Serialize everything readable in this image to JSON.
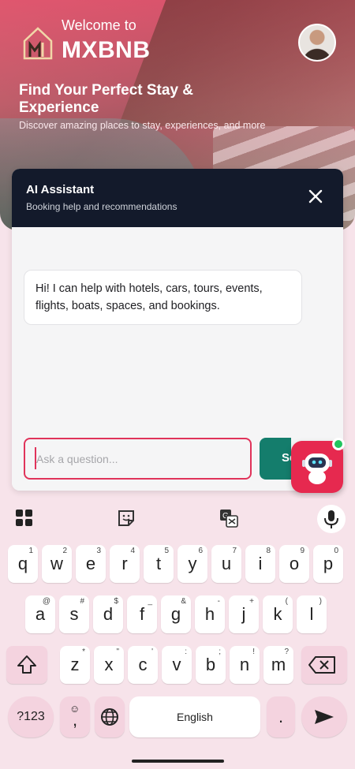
{
  "hero": {
    "welcome": "Welcome to",
    "brand": "MXBNB",
    "title": "Find Your Perfect Stay & Experience",
    "subtitle": "Discover amazing places to stay, experiences, and more"
  },
  "chat": {
    "title": "AI Assistant",
    "subtitle": "Booking help and recommendations",
    "message": "Hi! I can help with hotels, cars, tours, events, flights, boats, spaces, and bookings.",
    "input_placeholder": "Ask a question...",
    "input_value": "",
    "send_label": "Send"
  },
  "colors": {
    "accent": "#e6294f",
    "header_dark": "#131a2b",
    "send_green": "#147d6c",
    "online": "#22c55e"
  },
  "keyboard": {
    "row1": [
      {
        "k": "q",
        "h": "1"
      },
      {
        "k": "w",
        "h": "2"
      },
      {
        "k": "e",
        "h": "3"
      },
      {
        "k": "r",
        "h": "4"
      },
      {
        "k": "t",
        "h": "5"
      },
      {
        "k": "y",
        "h": "6"
      },
      {
        "k": "u",
        "h": "7"
      },
      {
        "k": "i",
        "h": "8"
      },
      {
        "k": "o",
        "h": "9"
      },
      {
        "k": "p",
        "h": "0"
      }
    ],
    "row2": [
      {
        "k": "a",
        "h": "@"
      },
      {
        "k": "s",
        "h": "#"
      },
      {
        "k": "d",
        "h": "$"
      },
      {
        "k": "f",
        "h": "_"
      },
      {
        "k": "g",
        "h": "&"
      },
      {
        "k": "h",
        "h": "-"
      },
      {
        "k": "j",
        "h": "+"
      },
      {
        "k": "k",
        "h": "("
      },
      {
        "k": "l",
        "h": ")"
      }
    ],
    "row3": [
      {
        "k": "z",
        "h": "*"
      },
      {
        "k": "x",
        "h": "\""
      },
      {
        "k": "c",
        "h": "'"
      },
      {
        "k": "v",
        "h": ":"
      },
      {
        "k": "b",
        "h": ";"
      },
      {
        "k": "n",
        "h": "!"
      },
      {
        "k": "m",
        "h": "?"
      }
    ],
    "symbols_label": "?123",
    "comma_label": ",",
    "space_label": "English",
    "period_label": "."
  }
}
